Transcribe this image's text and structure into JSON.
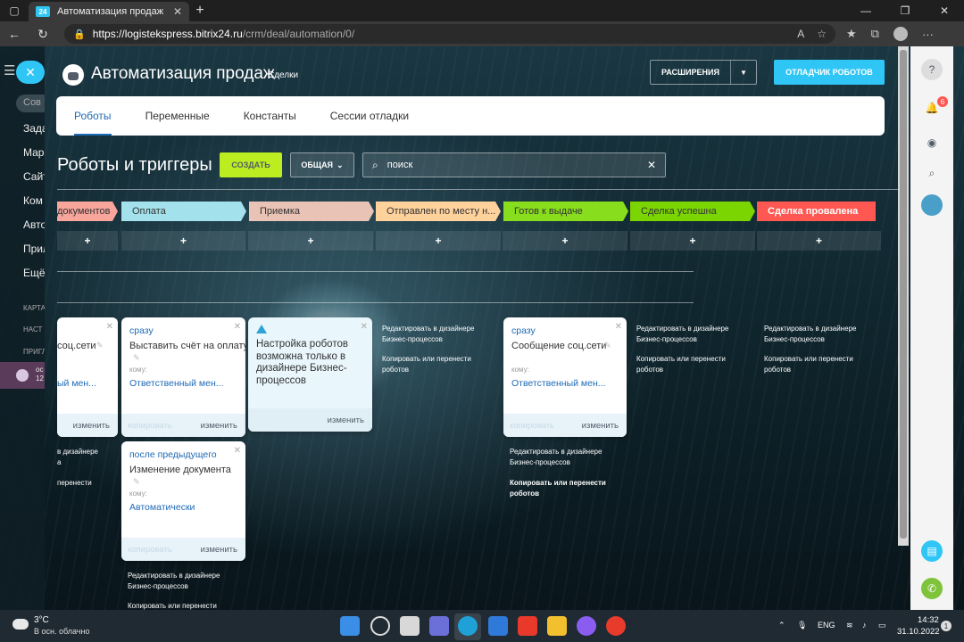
{
  "browser": {
    "tab_title": "Автоматизация продаж",
    "tab_favicon": "24",
    "url_host": "https://logistekspress.bitrix24.ru",
    "url_path": "/crm/deal/automation/0/"
  },
  "sidebar": {
    "search": "Сов",
    "items": [
      "Зада",
      "Мар",
      "Сайт",
      "Ком",
      "Авто",
      "Прил",
      "Ещё"
    ],
    "captions": [
      "КАРТА",
      "НАСТ",
      "ПРИГЛ"
    ],
    "market_line1": "ос",
    "market_line2": "12"
  },
  "header": {
    "title": "Автоматизация продаж",
    "subtitle": "Сделки",
    "extensions_label": "РАСШИРЕНИЯ",
    "debugger_label": "ОТЛАДЧИК РОБОТОВ"
  },
  "tabs": [
    "Роботы",
    "Переменные",
    "Константы",
    "Сессии отладки"
  ],
  "toolbar": {
    "section_title": "Роботы и триггеры",
    "create_label": "СОЗДАТЬ",
    "general_label": "ОБЩАЯ",
    "search_value": "поиск"
  },
  "stages": [
    {
      "name": "документов",
      "color": "#f8a59c"
    },
    {
      "name": "Оплата",
      "color": "#a3e1ec"
    },
    {
      "name": "Приемка",
      "color": "#e9c3b6"
    },
    {
      "name": "Отправлен по месту н...",
      "color": "#ffd29c"
    },
    {
      "name": "Готов к выдаче",
      "color": "#88dd1c"
    },
    {
      "name": "Сделка успешна",
      "color": "#7bd500"
    },
    {
      "name": "Сделка провалена",
      "color": "#ff5752"
    }
  ],
  "add_label": "+",
  "cards": {
    "c0": {
      "name": "соц.сети",
      "who": "ый мен...",
      "edit": "изменить"
    },
    "c1": {
      "when": "сразу",
      "name": "Выставить счёт на оплату",
      "who_label": "кому:",
      "who": "Ответственный мен...",
      "copy": "копировать",
      "edit": "изменить"
    },
    "c2": {
      "warning": "Настройка роботов возможна только в дизайнере Бизнес-процессов",
      "edit": "изменить"
    },
    "c3": {
      "when": "сразу",
      "name": "Сообщение соц.сети",
      "who_label": "кому:",
      "who": "Ответственный мен...",
      "copy": "копировать",
      "edit": "изменить"
    },
    "c4": {
      "when": "после предыдущего",
      "name": "Изменение документа",
      "who_label": "кому:",
      "who": "Автоматически",
      "copy": "копировать",
      "edit": "изменить"
    }
  },
  "aux": {
    "edit_designer": "Редактировать в дизайнере Бизнес-процессов",
    "copy_move": "Копировать или перенести роботов",
    "partial_edit": "в дизайнере\nа",
    "partial_copy": "перенести"
  },
  "right_panel": {
    "help": "?",
    "notif_count": "6"
  },
  "taskbar": {
    "temp": "3°C",
    "weather": "В осн. облачно",
    "lang": "ENG",
    "time": "14:32",
    "date": "31.10.2022",
    "notifications": "1"
  }
}
